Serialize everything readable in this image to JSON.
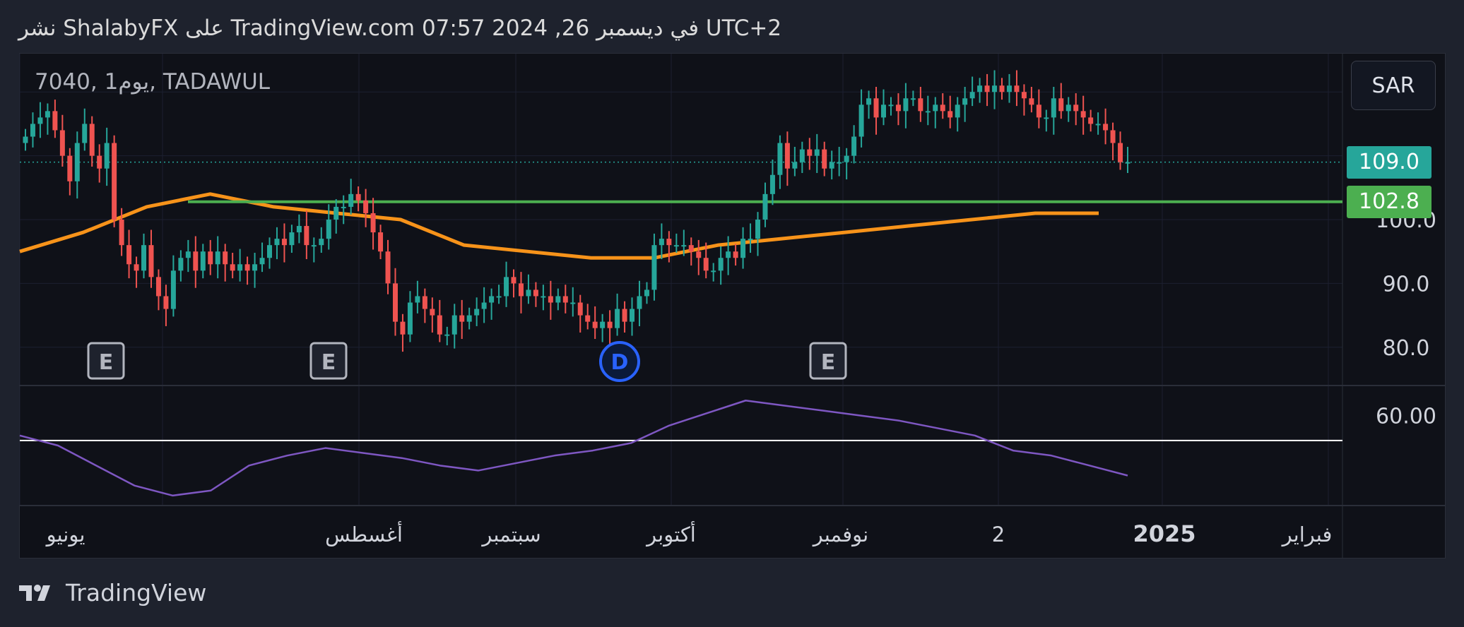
{
  "header": {
    "text": "نشر ShalabyFX على TradingView.com 07:57 2024 ,26 في ديسمبر UTC+2"
  },
  "symbol": "7040, 1يوم, TADAWUL",
  "currency": "SAR",
  "footer": {
    "brand": "TradingView"
  },
  "colors": {
    "up": "#26a69a",
    "down": "#ef5350",
    "ma": "#f7931a",
    "support": "#4caf50",
    "rsi": "#7e57c2",
    "bg": "#0f1118"
  },
  "price_tags": {
    "last": "109.0",
    "support": "102.8"
  },
  "chart_data": [
    {
      "type": "candlestick",
      "y_ticks": [
        "80.0",
        "90.0",
        "100.0"
      ],
      "ylim": [
        74,
        126
      ],
      "x_ticks": [
        "يونيو",
        "أغسطس",
        "سبتمبر",
        "أكتوبر",
        "نوفمبر",
        "2",
        "2025",
        "فبراير"
      ],
      "last_price": 109.0,
      "support_level": 102.8,
      "event_markers": [
        "E",
        "E",
        "D",
        "E"
      ],
      "close": [
        113,
        115,
        116,
        117,
        114,
        110,
        106,
        112,
        115,
        110,
        108,
        112,
        100,
        96,
        93,
        92,
        96,
        91,
        88,
        86,
        92,
        94,
        95,
        92,
        95,
        93,
        95,
        93,
        92,
        93,
        92,
        93,
        94,
        96,
        97,
        96,
        98,
        99,
        96,
        96,
        97,
        100,
        102,
        102,
        104,
        103,
        101,
        98,
        95,
        90,
        84,
        82,
        87,
        88,
        86,
        85,
        82,
        82,
        85,
        84,
        85,
        86,
        87,
        88,
        88,
        91,
        90,
        88,
        89,
        88,
        88,
        87,
        88,
        87,
        87,
        85,
        84,
        83,
        84,
        83,
        86,
        84,
        86,
        88,
        89,
        96,
        97,
        96,
        96,
        96,
        95,
        94,
        92,
        92,
        94,
        95,
        94,
        97,
        97,
        100,
        104,
        107,
        112,
        108,
        109,
        111,
        110,
        111,
        108,
        109,
        109,
        110,
        113,
        118,
        119,
        116,
        118,
        118,
        117,
        119,
        119,
        117,
        117,
        118,
        117,
        116,
        118,
        119,
        120,
        121,
        120,
        121,
        120,
        121,
        120,
        119,
        118,
        116,
        116,
        119,
        117,
        118,
        117,
        116,
        115,
        115,
        114,
        112,
        109,
        109
      ],
      "ma": [
        95,
        98,
        102,
        104,
        102,
        101,
        100,
        96,
        95,
        94,
        94,
        96,
        97,
        98,
        99,
        100,
        101,
        101
      ],
      "rsi": [
        52,
        48,
        40,
        32,
        28,
        30,
        40,
        44,
        47,
        45,
        43,
        40,
        38,
        41,
        44,
        46,
        49,
        56,
        61,
        66,
        64,
        62,
        60,
        58,
        55,
        52,
        46,
        44,
        40,
        36
      ]
    }
  ]
}
